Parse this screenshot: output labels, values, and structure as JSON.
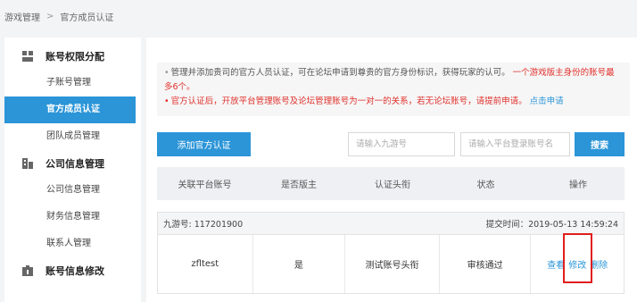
{
  "breadcrumb": {
    "parent": "游戏管理",
    "separator": ">",
    "current": "官方成员认证"
  },
  "sidebar": {
    "groups": [
      {
        "label": "账号权限分配",
        "icon": "account-permission-icon",
        "items": [
          "子账号管理",
          "官方成员认证",
          "团队成员管理"
        ]
      },
      {
        "label": "公司信息管理",
        "icon": "company-icon",
        "items": [
          "公司信息管理",
          "财务信息管理",
          "联系人管理"
        ]
      },
      {
        "label": "账号信息修改",
        "icon": "account-edit-icon",
        "items": []
      }
    ],
    "active_item": "官方成员认证"
  },
  "notice": {
    "line1_normal": "管理并添加贵司的官方人员认证，可在论坛申请到尊贵的官方身份标识，获得玩家的认可。",
    "line1_red": "一个游戏版主身份的账号最多6个。",
    "line2_red": "官方认证后，开放平台管理账号及论坛管理账号为一对一的关系，若无论坛账号，请提前申请。",
    "line2_link": "点击申请"
  },
  "toolbar": {
    "add_label": "添加官方认证",
    "search_jiuyou_placeholder": "请输入九游号",
    "search_account_placeholder": "请输入平台登录账号名",
    "search_label": "搜索"
  },
  "table": {
    "headers": [
      "关联平台账号",
      "是否版主",
      "认证头衔",
      "状态",
      "操作"
    ],
    "records": [
      {
        "jiuyou_label": "九游号: 117201900",
        "submit_time": "提交时间：2019-05-13 14:59:24",
        "account": "zfltest",
        "is_moderator": "是",
        "title": "测试账号头衔",
        "status": "审核通过",
        "actions": {
          "view": "查看",
          "edit": "修改",
          "delete": "删除"
        }
      }
    ]
  },
  "colors": {
    "primary": "#2b95d8",
    "danger": "#e0302c",
    "highlight_box": "#e01e1e"
  }
}
